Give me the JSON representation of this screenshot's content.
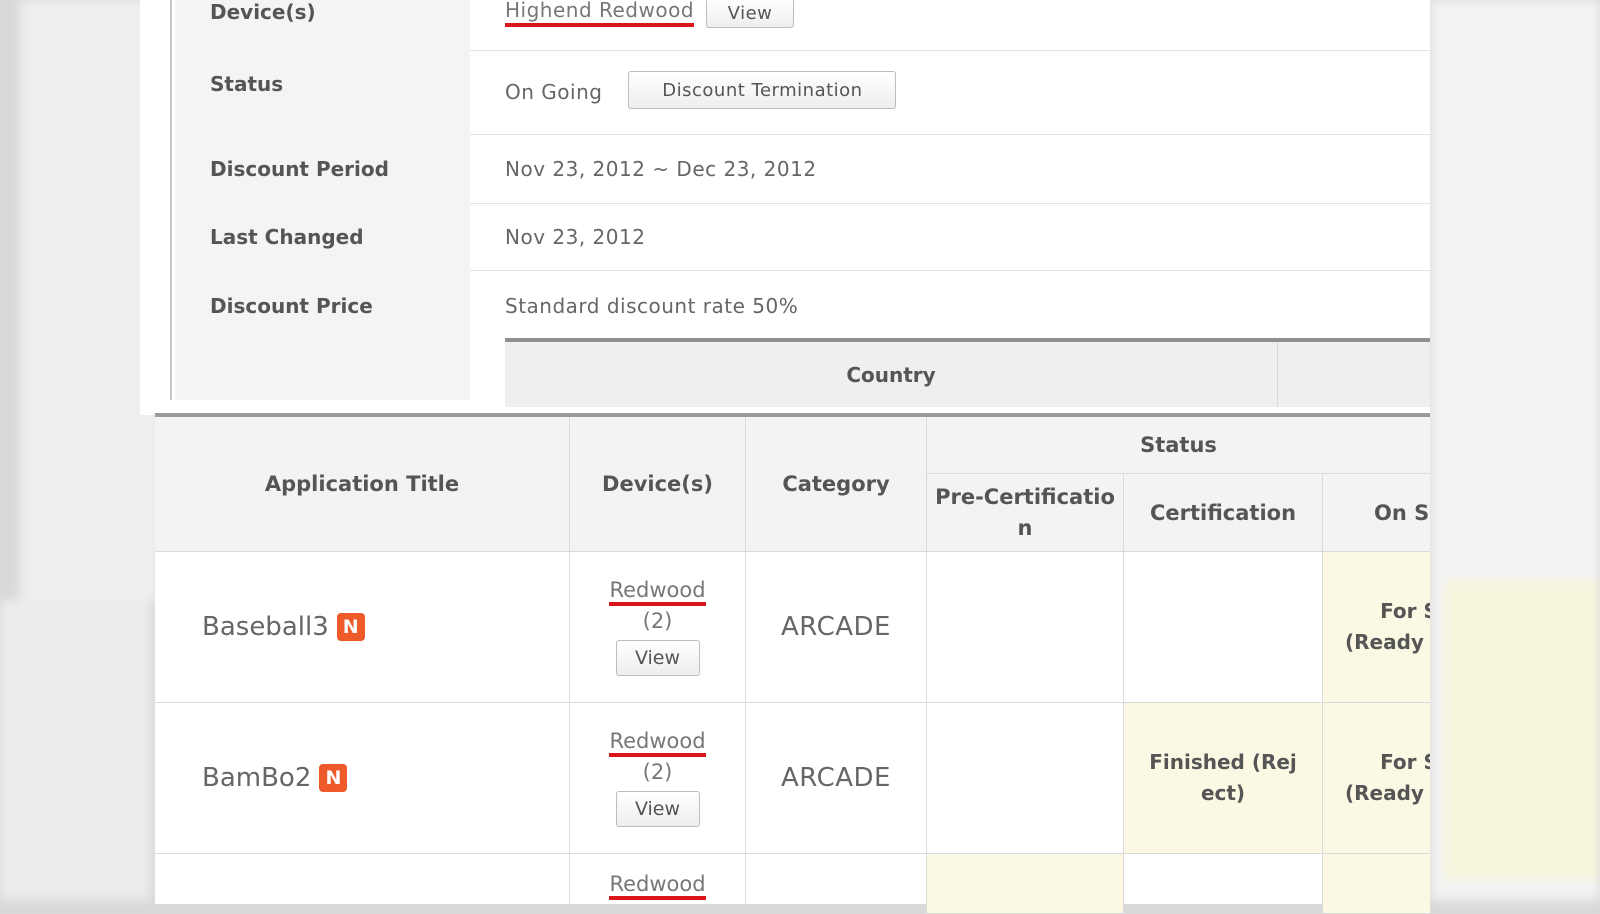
{
  "details": {
    "devices": {
      "label": "Device(s)",
      "value": "Highend Redwood",
      "button": "View"
    },
    "status": {
      "label": "Status",
      "value": "On Going",
      "button": "Discount Termination"
    },
    "period": {
      "label": "Discount Period",
      "value": "Nov 23, 2012 ~ Dec 23, 2012"
    },
    "last_changed": {
      "label": "Last Changed",
      "value": "Nov 23, 2012"
    },
    "price": {
      "label": "Discount Price",
      "value": "Standard discount rate 50%"
    },
    "country_header": "Country"
  },
  "table": {
    "headers": {
      "app_title": "Application Title",
      "devices": "Device(s)",
      "category": "Category",
      "status": "Status",
      "pre_cert": "Pre-Certificatio n",
      "cert": "Certification",
      "on_sale": "On S"
    },
    "rows": [
      {
        "title": "Baseball3",
        "badge": "N",
        "device": "Redwood",
        "device_count": "(2)",
        "view": "View",
        "category": "ARCADE",
        "pre_cert": "",
        "cert": "",
        "on_sale": "For S (Ready ang"
      },
      {
        "title": "BamBo2",
        "badge": "N",
        "device": "Redwood",
        "device_count": "(2)",
        "view": "View",
        "category": "ARCADE",
        "pre_cert": "",
        "cert": "Finished (Rej ect)",
        "on_sale": "For S (Ready ang"
      },
      {
        "device": "Redwood"
      }
    ]
  },
  "colors": {
    "accent_underline": "#d9161b",
    "badge": "#ef5a2b",
    "highlight": "#fbf9e3"
  }
}
